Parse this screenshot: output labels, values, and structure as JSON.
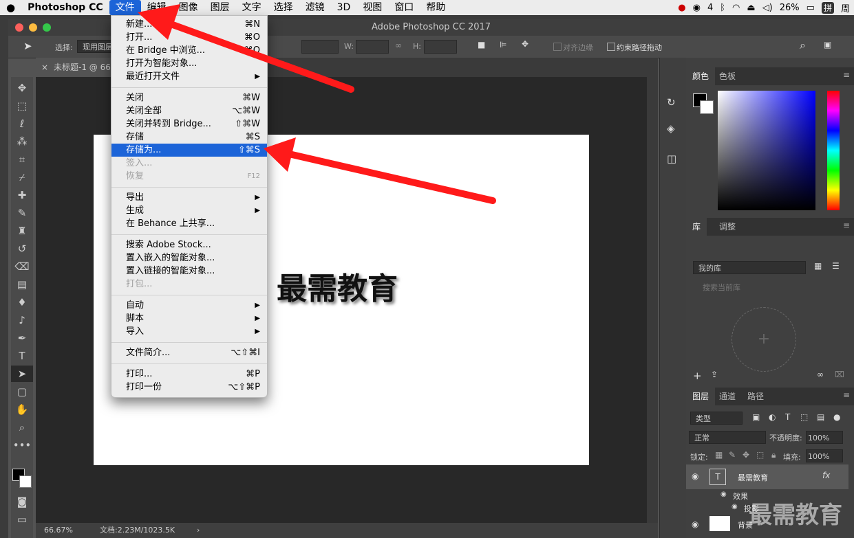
{
  "menubar": {
    "apple": "",
    "app": "Photoshop CC",
    "items": [
      "文件",
      "编辑",
      "图像",
      "图层",
      "文字",
      "选择",
      "滤镜",
      "3D",
      "视图",
      "窗口",
      "帮助"
    ],
    "status": {
      "wechat_count": "4",
      "battery": "26%",
      "ime": "拼",
      "user": "周"
    }
  },
  "window": {
    "title": "Adobe Photoshop CC 2017"
  },
  "options_bar": {
    "select_label": "选择:",
    "select_value": "现用图层",
    "w_label": "W:",
    "h_label": "H:",
    "align_edges": "对齐边缘",
    "constrain_path": "约束路径拖动"
  },
  "document": {
    "tab_title": "未标题-1 @ 66.",
    "canvas_text": "最需教育",
    "zoom": "66.67%",
    "doc_info": "文档:2.23M/1023.5K"
  },
  "file_menu": {
    "items": [
      {
        "label": "新建...",
        "shortcut": "⌘N"
      },
      {
        "label": "打开...",
        "shortcut": "⌘O"
      },
      {
        "label": "在 Bridge 中浏览...",
        "shortcut": "⌥⌘O"
      },
      {
        "label": "打开为智能对象...",
        "shortcut": ""
      },
      {
        "label": "最近打开文件",
        "shortcut": "▶"
      },
      {
        "label": "关闭",
        "shortcut": "⌘W"
      },
      {
        "label": "关闭全部",
        "shortcut": "⌥⌘W"
      },
      {
        "label": "关闭并转到 Bridge...",
        "shortcut": "⇧⌘W"
      },
      {
        "label": "存储",
        "shortcut": "⌘S"
      },
      {
        "label": "存储为...",
        "shortcut": "⇧⌘S"
      },
      {
        "label": "签入...",
        "shortcut": ""
      },
      {
        "label": "恢复",
        "shortcut": "F12"
      },
      {
        "label": "导出",
        "shortcut": "▶"
      },
      {
        "label": "生成",
        "shortcut": "▶"
      },
      {
        "label": "在 Behance 上共享...",
        "shortcut": ""
      },
      {
        "label": "搜索 Adobe Stock...",
        "shortcut": ""
      },
      {
        "label": "置入嵌入的智能对象...",
        "shortcut": ""
      },
      {
        "label": "置入链接的智能对象...",
        "shortcut": ""
      },
      {
        "label": "打包...",
        "shortcut": ""
      },
      {
        "label": "自动",
        "shortcut": "▶"
      },
      {
        "label": "脚本",
        "shortcut": "▶"
      },
      {
        "label": "导入",
        "shortcut": "▶"
      },
      {
        "label": "文件简介...",
        "shortcut": "⌥⇧⌘I"
      },
      {
        "label": "打印...",
        "shortcut": "⌘P"
      },
      {
        "label": "打印一份",
        "shortcut": "⌥⇧⌘P"
      }
    ]
  },
  "panels": {
    "color_tabs": [
      "颜色",
      "色板"
    ],
    "library_tabs": [
      "库",
      "调整"
    ],
    "library_select": "我的库",
    "library_search_placeholder": "搜索当前库",
    "layer_tabs": [
      "图层",
      "通道",
      "路径"
    ],
    "layer_filter": "类型",
    "blend_mode": "正常",
    "opacity_label": "不透明度:",
    "opacity_value": "100%",
    "lock_label": "锁定:",
    "fill_label": "填充:",
    "fill_value": "100%",
    "layers": [
      {
        "name": "最需教育"
      },
      {
        "name": "效果"
      },
      {
        "name": "投影"
      },
      {
        "name": "背景"
      }
    ]
  },
  "watermark": "最需教育",
  "colors": {
    "menu_highlight": "#1c64d8",
    "arrow": "#ff1a1a"
  }
}
